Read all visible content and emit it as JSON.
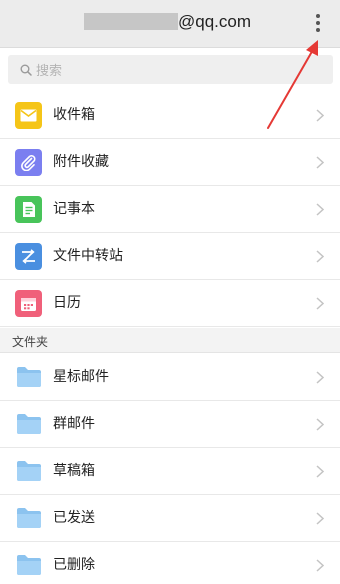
{
  "header": {
    "email_domain": "@qq.com"
  },
  "search": {
    "placeholder": "搜索"
  },
  "primary_items": [
    {
      "label": "收件箱",
      "icon": "inbox-icon",
      "color": "#f5c518"
    },
    {
      "label": "附件收藏",
      "icon": "paperclip-icon",
      "color": "#7b7ff0"
    },
    {
      "label": "记事本",
      "icon": "note-icon",
      "color": "#48c45a"
    },
    {
      "label": "文件中转站",
      "icon": "transfer-icon",
      "color": "#4a8fe0"
    },
    {
      "label": "日历",
      "icon": "calendar-icon",
      "color": "#f0607a"
    }
  ],
  "folders_section": {
    "title": "文件夹",
    "items": [
      {
        "label": "星标邮件",
        "icon": "folder-icon"
      },
      {
        "label": "群邮件",
        "icon": "folder-icon"
      },
      {
        "label": "草稿箱",
        "icon": "folder-icon"
      },
      {
        "label": "已发送",
        "icon": "folder-icon"
      },
      {
        "label": "已删除",
        "icon": "folder-icon"
      }
    ]
  },
  "colors": {
    "folder": "#8cc3ef",
    "annotation_arrow": "#e53935"
  }
}
